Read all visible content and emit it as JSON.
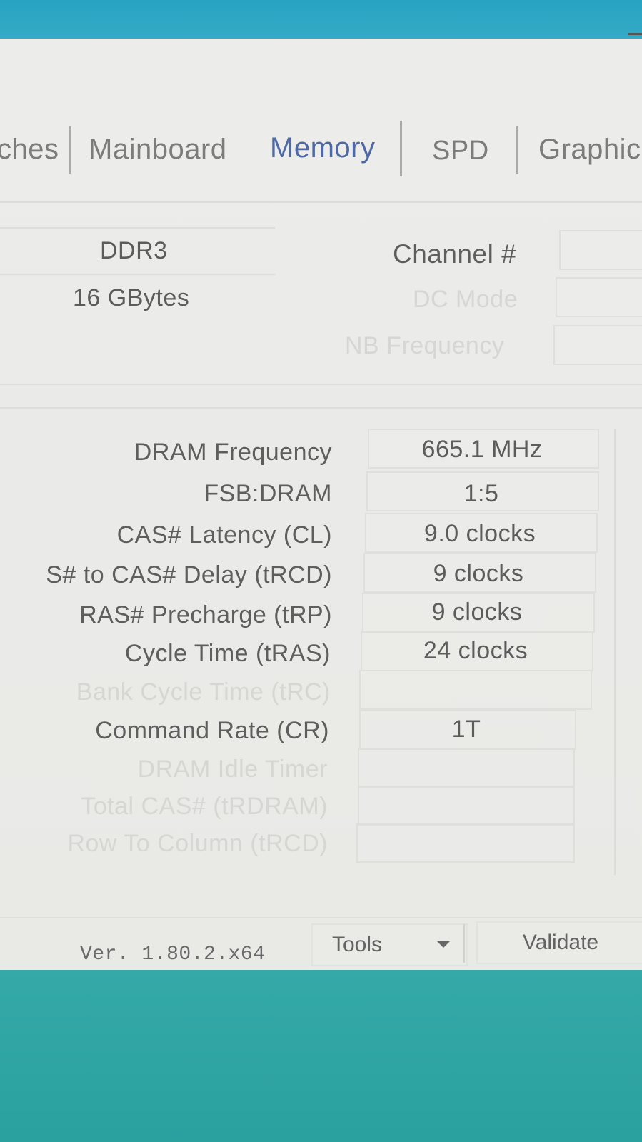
{
  "tabs": [
    {
      "label": "ches"
    },
    {
      "label": "Mainboard"
    },
    {
      "label": "Memory"
    },
    {
      "label": "SPD"
    },
    {
      "label": "Graphic"
    }
  ],
  "general": {
    "type_value": "DDR3",
    "size_value": "16 GBytes",
    "channel_label": "Channel #",
    "dc_mode_label": "DC Mode",
    "nb_frequency_label": "NB Frequency"
  },
  "timings": [
    {
      "label": "DRAM Frequency",
      "value": "665.1 MHz"
    },
    {
      "label": "FSB:DRAM",
      "value": "1:5"
    },
    {
      "label": "CAS# Latency (CL)",
      "value": "9.0 clocks"
    },
    {
      "label": "S# to CAS# Delay (tRCD)",
      "value": "9 clocks"
    },
    {
      "label": "RAS# Precharge (tRP)",
      "value": "9 clocks"
    },
    {
      "label": "Cycle Time (tRAS)",
      "value": "24 clocks"
    },
    {
      "label": "Bank Cycle Time (tRC)",
      "value": ""
    },
    {
      "label": "Command Rate (CR)",
      "value": "1T"
    },
    {
      "label": "DRAM Idle Timer",
      "value": ""
    },
    {
      "label": "Total CAS# (tRDRAM)",
      "value": ""
    },
    {
      "label": "Row To Column (tRCD)",
      "value": ""
    }
  ],
  "footer": {
    "version": "Ver. 1.80.2.x64",
    "tools_label": "Tools",
    "validate_label": "Validate"
  }
}
